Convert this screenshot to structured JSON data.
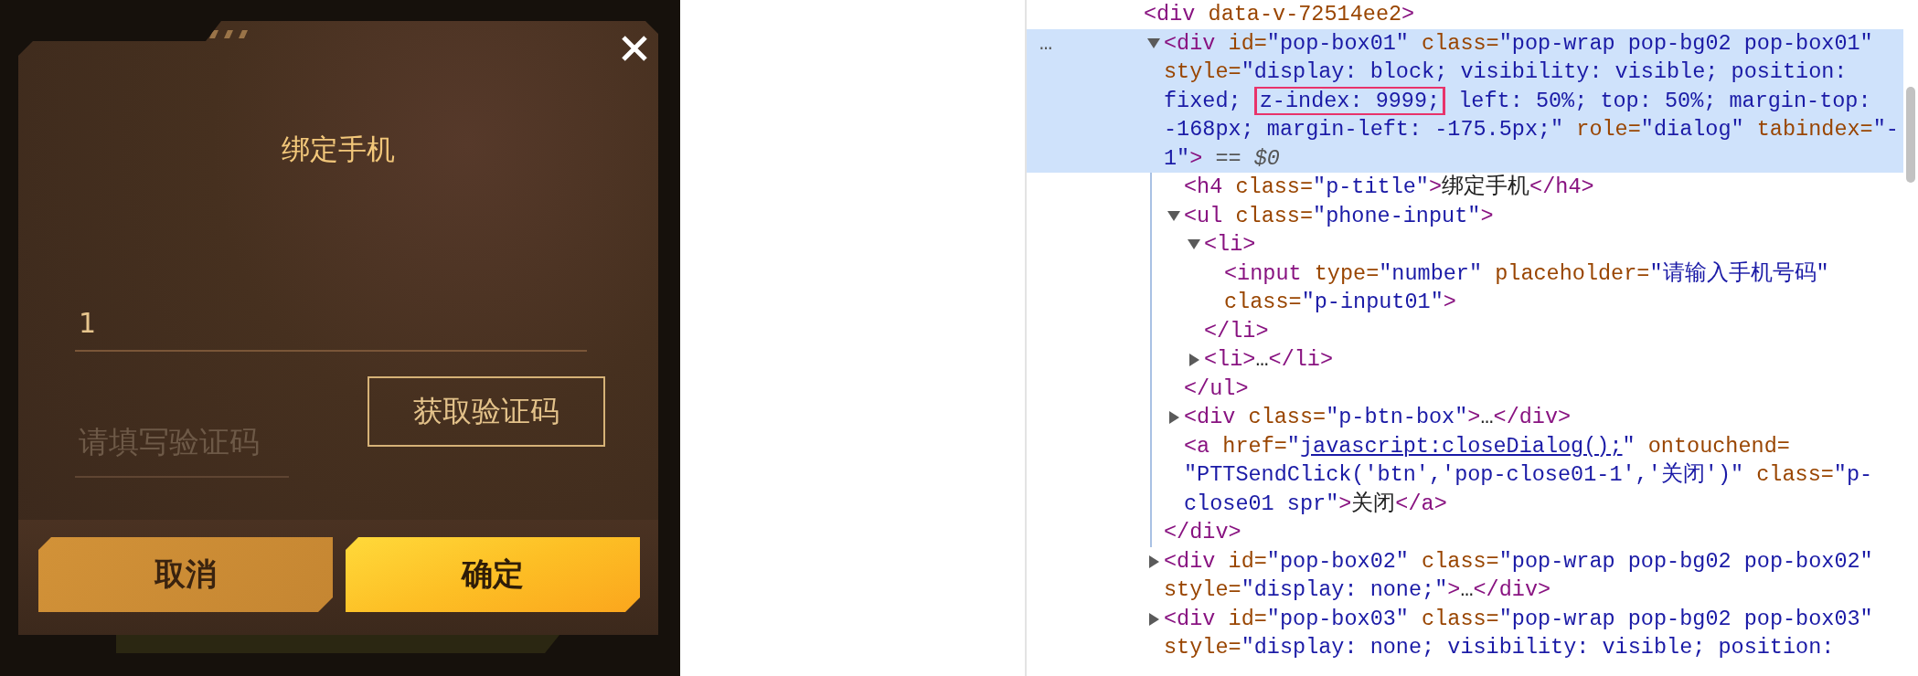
{
  "dialog": {
    "title": "绑定手机",
    "phone_field": {
      "value": "1"
    },
    "code_field": {
      "placeholder": "请填写验证码"
    },
    "get_code_button": "获取验证码",
    "buttons": [
      {
        "label": "取消",
        "kind": "secondary"
      },
      {
        "label": "确定",
        "kind": "primary"
      }
    ]
  },
  "elements_panel": {
    "tree": {
      "selected": false,
      "tokens": [
        {
          "kind": "tag",
          "text": "<div"
        },
        {
          "kind": "attr",
          "text": " data-v-72514ee2"
        },
        {
          "kind": "tag",
          "text": ">"
        }
      ],
      "children": [
        {
          "selected": true,
          "expanded": true,
          "gutter_mark": "…",
          "tokens": [
            {
              "kind": "tag",
              "text": "<div"
            },
            {
              "kind": "attr",
              "text": " id="
            },
            {
              "kind": "value",
              "text": "\"pop-box01\""
            },
            {
              "kind": "attr",
              "text": " class="
            },
            {
              "kind": "value",
              "text": "\"pop-wrap pop-bg02 pop-box01\""
            },
            {
              "kind": "attr",
              "text": " style="
            },
            {
              "kind": "value",
              "text": "\"display: block; visibility: visible; position: fixed; "
            },
            {
              "kind": "highlight",
              "text": "z-index: 9999;"
            },
            {
              "kind": "value",
              "text": " left: 50%; top: 50%; margin-top: -168px; margin-left: -175.5px;\""
            },
            {
              "kind": "attr",
              "text": " role="
            },
            {
              "kind": "value",
              "text": "\"dialog\""
            },
            {
              "kind": "attr",
              "text": " tabindex="
            },
            {
              "kind": "value",
              "text": "\"-1\""
            },
            {
              "kind": "tag",
              "text": ">"
            },
            {
              "kind": "hint",
              "text": " == *$0*"
            }
          ],
          "children": [
            {
              "selected": false,
              "tokens": [
                {
                  "kind": "tag",
                  "text": "<h4"
                },
                {
                  "kind": "attr",
                  "text": " class="
                },
                {
                  "kind": "value",
                  "text": "\"p-title\""
                },
                {
                  "kind": "tag",
                  "text": ">"
                },
                {
                  "kind": "text",
                  "text": "绑定手机"
                },
                {
                  "kind": "tag",
                  "text": "</h4>"
                }
              ]
            },
            {
              "selected": false,
              "expanded": true,
              "tokens": [
                {
                  "kind": "tag",
                  "text": "<ul"
                },
                {
                  "kind": "attr",
                  "text": " class="
                },
                {
                  "kind": "value",
                  "text": "\"phone-input\""
                },
                {
                  "kind": "tag",
                  "text": ">"
                }
              ],
              "children": [
                {
                  "selected": false,
                  "expanded": true,
                  "tokens": [
                    {
                      "kind": "tag",
                      "text": "<li>"
                    }
                  ],
                  "children": [
                    {
                      "selected": false,
                      "tokens": [
                        {
                          "kind": "tag",
                          "text": "<input"
                        },
                        {
                          "kind": "attr",
                          "text": " type="
                        },
                        {
                          "kind": "value",
                          "text": "\"number\""
                        },
                        {
                          "kind": "attr",
                          "text": " placeholder="
                        },
                        {
                          "kind": "value",
                          "text": "\"请输入手机号码\""
                        },
                        {
                          "kind": "attr",
                          "text": " class="
                        },
                        {
                          "kind": "value",
                          "text": "\"p-input01\""
                        },
                        {
                          "kind": "tag",
                          "text": ">"
                        }
                      ]
                    }
                  ],
                  "close": [
                    {
                      "kind": "tag",
                      "text": "</li>"
                    }
                  ]
                },
                {
                  "selected": false,
                  "expanded": false,
                  "tokens": [
                    {
                      "kind": "tag",
                      "text": "<li>"
                    },
                    {
                      "kind": "text",
                      "text": "…"
                    },
                    {
                      "kind": "tag",
                      "text": "</li>"
                    }
                  ]
                }
              ],
              "close": [
                {
                  "kind": "tag",
                  "text": "</ul>"
                }
              ]
            },
            {
              "selected": false,
              "expanded": false,
              "tokens": [
                {
                  "kind": "tag",
                  "text": "<div"
                },
                {
                  "kind": "attr",
                  "text": " class="
                },
                {
                  "kind": "value",
                  "text": "\"p-btn-box\""
                },
                {
                  "kind": "tag",
                  "text": ">"
                },
                {
                  "kind": "text",
                  "text": "…"
                },
                {
                  "kind": "tag",
                  "text": "</div>"
                }
              ]
            },
            {
              "selected": false,
              "tokens": [
                {
                  "kind": "tag",
                  "text": "<a"
                },
                {
                  "kind": "attr",
                  "text": " href="
                },
                {
                  "kind": "value",
                  "text": "\""
                },
                {
                  "kind": "link",
                  "text": "javascript:closeDialog();"
                },
                {
                  "kind": "value",
                  "text": "\""
                },
                {
                  "kind": "attr",
                  "text": " ontouchend="
                },
                {
                  "kind": "value",
                  "text": "\"PTTSendClick('btn','pop-close01-1','关闭')\""
                },
                {
                  "kind": "attr",
                  "text": " class="
                },
                {
                  "kind": "value",
                  "text": "\"p-close01 spr\""
                },
                {
                  "kind": "tag",
                  "text": ">"
                },
                {
                  "kind": "text",
                  "text": "关闭"
                },
                {
                  "kind": "tag",
                  "text": "</a>"
                }
              ]
            }
          ],
          "close": [
            {
              "kind": "tag",
              "text": "</div>"
            }
          ]
        },
        {
          "selected": false,
          "expanded": false,
          "tokens": [
            {
              "kind": "tag",
              "text": "<div"
            },
            {
              "kind": "attr",
              "text": " id="
            },
            {
              "kind": "value",
              "text": "\"pop-box02\""
            },
            {
              "kind": "attr",
              "text": " class="
            },
            {
              "kind": "value",
              "text": "\"pop-wrap pop-bg02 pop-box02\""
            },
            {
              "kind": "attr",
              "text": " style="
            },
            {
              "kind": "value",
              "text": "\"display: none;\""
            },
            {
              "kind": "tag",
              "text": ">"
            },
            {
              "kind": "text",
              "text": "…"
            },
            {
              "kind": "tag",
              "text": "</div>"
            }
          ]
        },
        {
          "selected": false,
          "expanded": false,
          "tokens": [
            {
              "kind": "tag",
              "text": "<div"
            },
            {
              "kind": "attr",
              "text": " id="
            },
            {
              "kind": "value",
              "text": "\"pop-box03\""
            },
            {
              "kind": "attr",
              "text": " class="
            },
            {
              "kind": "value",
              "text": "\"pop-wrap pop-bg02 pop-box03\""
            },
            {
              "kind": "attr",
              "text": " style="
            },
            {
              "kind": "value",
              "text": "\"display: none; visibility: visible; position:"
            }
          ]
        }
      ]
    }
  }
}
